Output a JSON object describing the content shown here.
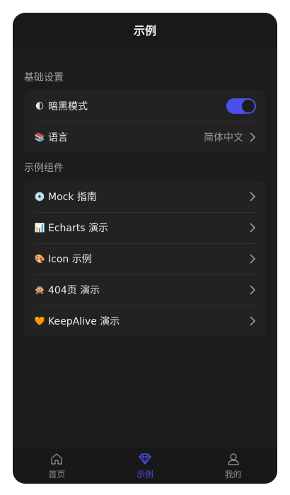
{
  "navbar": {
    "title": "示例"
  },
  "sections": {
    "basic": {
      "title": "基础设置",
      "dark_mode": {
        "emoji": "🌓",
        "label": "暗黑模式",
        "enabled": true
      },
      "language": {
        "emoji": "📚",
        "label": "语言",
        "value": "简体中文"
      }
    },
    "components": {
      "title": "示例组件",
      "items": [
        {
          "emoji": "💿",
          "label": "Mock 指南"
        },
        {
          "emoji": "📊",
          "label": "Echarts 演示"
        },
        {
          "emoji": "🎨",
          "label": "Icon 示例"
        },
        {
          "emoji": "🙊",
          "label": "404页 演示"
        },
        {
          "emoji": "🧡",
          "label": "KeepAlive 演示"
        }
      ]
    }
  },
  "tabbar": {
    "items": [
      {
        "label": "首页",
        "icon": "home-icon",
        "active": false
      },
      {
        "label": "示例",
        "icon": "diamond-icon",
        "active": true
      },
      {
        "label": "我的",
        "icon": "user-icon",
        "active": false
      }
    ]
  },
  "colors": {
    "accent": "#4b4ee8",
    "background": "#1c1c1d",
    "card": "#222223"
  }
}
